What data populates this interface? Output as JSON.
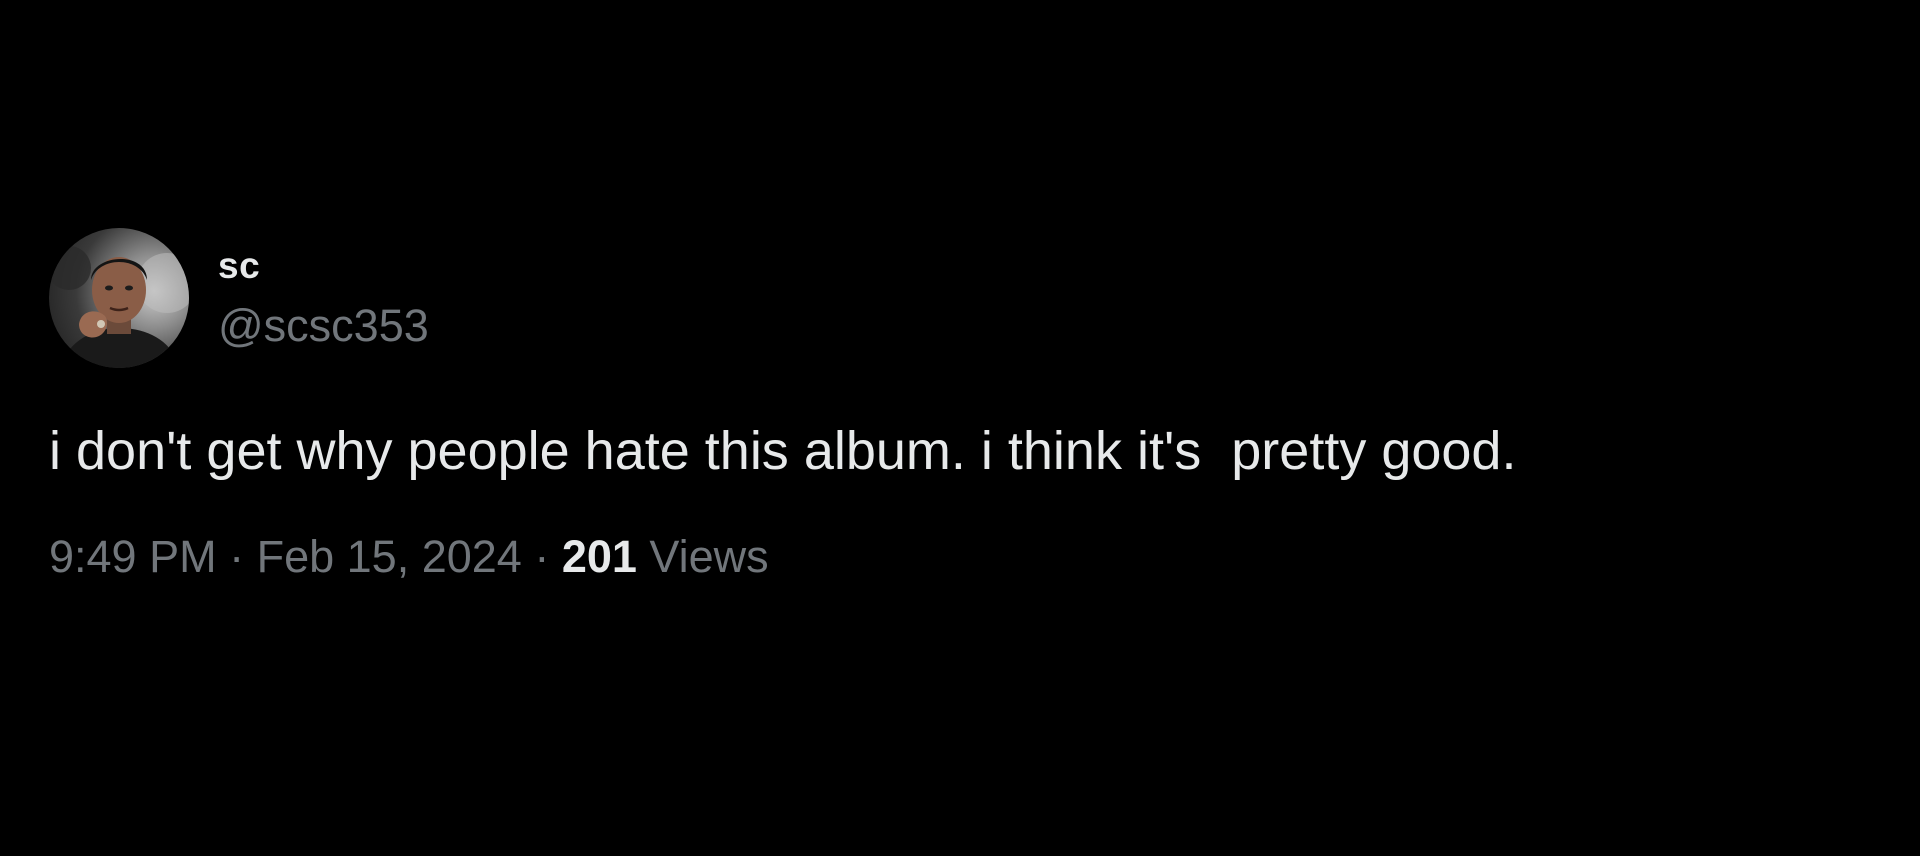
{
  "tweet": {
    "author": {
      "display_name": "sc",
      "handle": "@scsc353",
      "avatar_icon": "profile-photo"
    },
    "text": "i don't get why people hate this album. i think it's  pretty good.",
    "time": "9:49 PM",
    "separator": " · ",
    "date": "Feb 15, 2024",
    "views_count": "201",
    "views_label": "Views"
  },
  "colors": {
    "background": "#000000",
    "primary_text": "#e7e9ea",
    "secondary_text": "#71767b"
  }
}
